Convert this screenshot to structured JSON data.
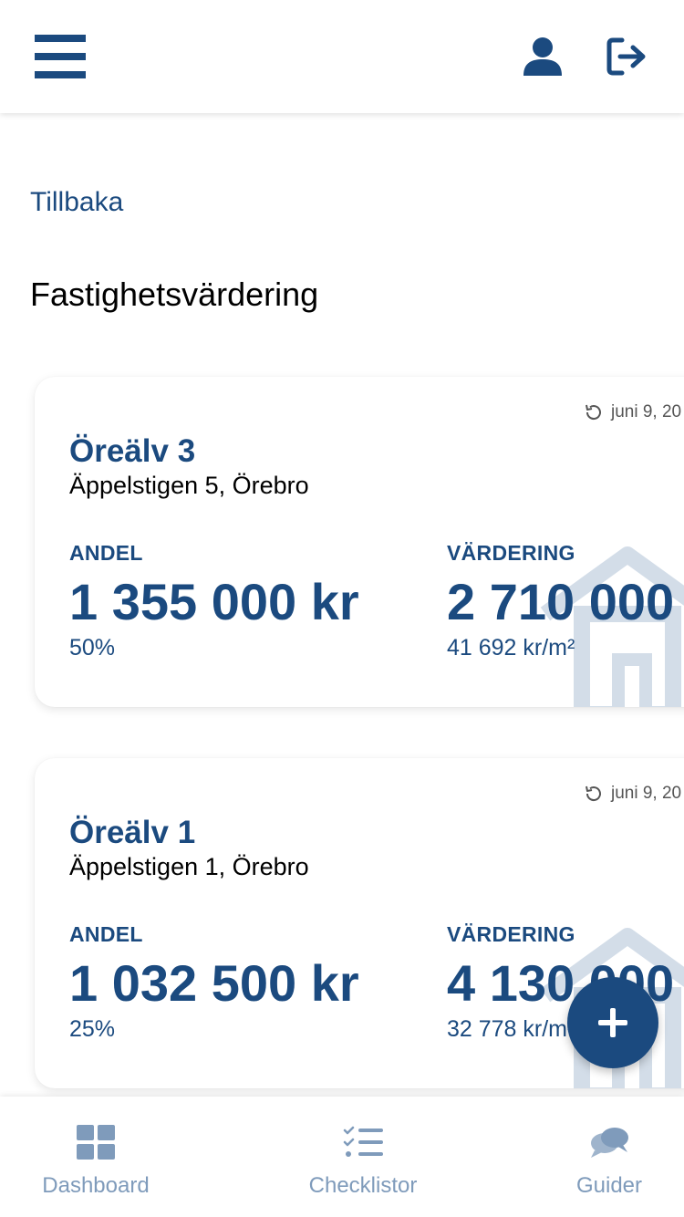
{
  "header": {
    "menu_icon": "hamburger-menu-icon",
    "user_icon": "user-icon",
    "logout_icon": "logout-icon"
  },
  "back_link": "Tillbaka",
  "page_title": "Fastighetsvärdering",
  "properties": [
    {
      "name": "Öreälv 3",
      "address": "Äppelstigen 5, Örebro",
      "date": "juni 9, 20",
      "share_label": "ANDEL",
      "share_value": "1 355 000 kr",
      "share_percent": "50%",
      "valuation_label": "VÄRDERING",
      "valuation_value": "2 710 000",
      "price_per_sqm": "41 692 kr/m²"
    },
    {
      "name": "Öreälv 1",
      "address": "Äppelstigen 1, Örebro",
      "date": "juni 9, 20",
      "share_label": "ANDEL",
      "share_value": "1 032 500 kr",
      "share_percent": "25%",
      "valuation_label": "VÄRDERING",
      "valuation_value": "4 130 000",
      "price_per_sqm": "32 778 kr/m²"
    }
  ],
  "fab": {
    "icon": "plus-icon"
  },
  "bottom_nav": [
    {
      "label": "Dashboard",
      "icon": "dashboard-grid-icon"
    },
    {
      "label": "Checklistor",
      "icon": "checklist-icon"
    },
    {
      "label": "Guider",
      "icon": "chat-bubbles-icon"
    }
  ],
  "colors": {
    "primary": "#1b4a7f",
    "nav_inactive": "#7f9bbb",
    "house_watermark": "#d3dde8"
  }
}
